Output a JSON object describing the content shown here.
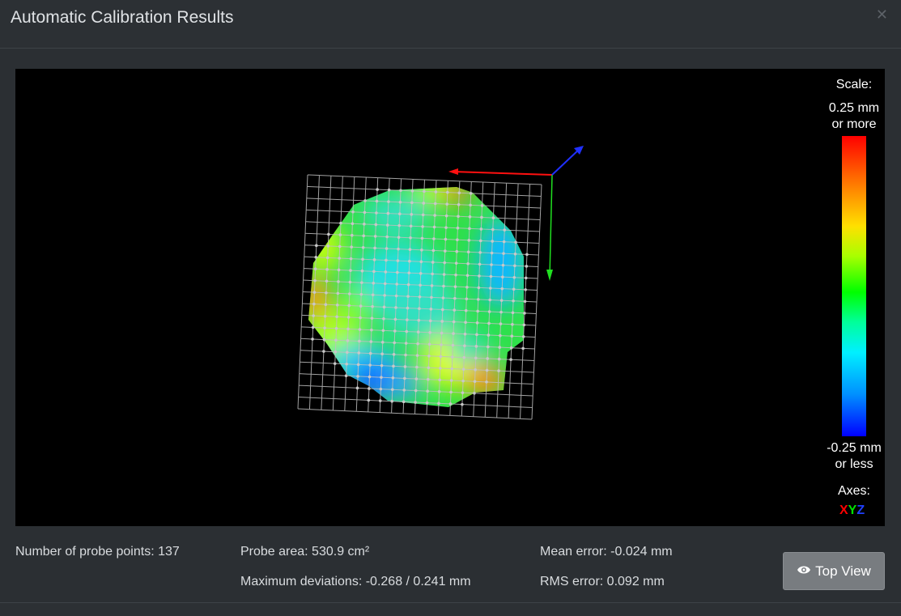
{
  "dialog": {
    "title": "Automatic Calibration Results",
    "close_icon": "close-icon"
  },
  "viewport": {
    "scale_title": "Scale:",
    "scale_max_line1": "0.25 mm",
    "scale_max_line2": "or more",
    "scale_min_line1": "-0.25 mm",
    "scale_min_line2": "or less",
    "axes_title": "Axes:",
    "axis_x": "X",
    "axis_y": "Y",
    "axis_z": "Z",
    "axis_colors": {
      "x": "#ff0000",
      "y": "#00ff00",
      "z": "#2040ff"
    }
  },
  "stats": {
    "probe_points": "Number of probe points: 137",
    "probe_area": "Probe area: 530.9 cm²",
    "max_deviation": "Maximum deviations: -0.268 / 0.241 mm",
    "mean_error": "Mean error: -0.024 mm",
    "rms_error": "RMS error: 0.092 mm"
  },
  "buttons": {
    "top_view_label": "Top View",
    "top_view_icon": "eye-icon"
  }
}
